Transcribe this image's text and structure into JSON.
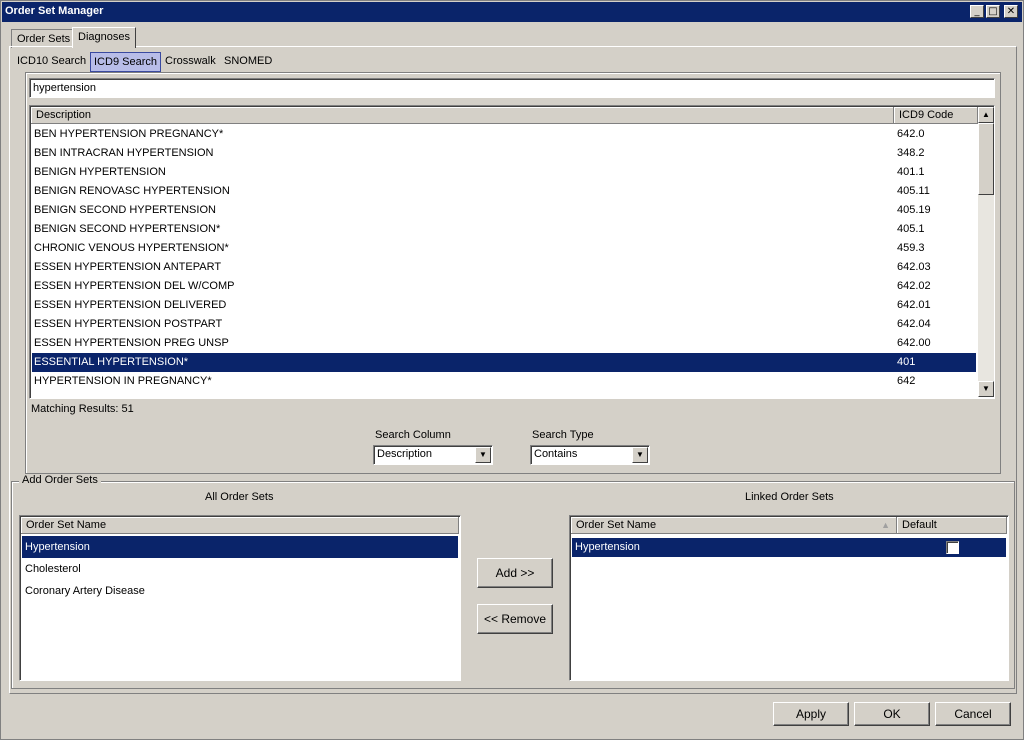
{
  "window": {
    "title": "Order Set Manager"
  },
  "tabs": [
    {
      "label": "Order Sets"
    },
    {
      "label": "Diagnoses"
    }
  ],
  "subtabs": [
    {
      "label": "ICD10 Search"
    },
    {
      "label": "ICD9 Search"
    },
    {
      "label": "Crosswalk"
    },
    {
      "label": "SNOMED"
    }
  ],
  "search": {
    "value": "hypertension"
  },
  "results": {
    "columns": [
      "Description",
      "ICD9 Code"
    ],
    "rows": [
      {
        "desc": "BEN HYPERTENSION PREGNANCY*",
        "code": "642.0"
      },
      {
        "desc": "BEN INTRACRAN HYPERTENSION",
        "code": "348.2"
      },
      {
        "desc": "BENIGN HYPERTENSION",
        "code": "401.1"
      },
      {
        "desc": "BENIGN RENOVASC HYPERTENSION",
        "code": "405.11"
      },
      {
        "desc": "BENIGN SECOND HYPERTENSION",
        "code": "405.19"
      },
      {
        "desc": "BENIGN SECOND HYPERTENSION*",
        "code": "405.1"
      },
      {
        "desc": "CHRONIC VENOUS HYPERTENSION*",
        "code": "459.3"
      },
      {
        "desc": "ESSEN HYPERTENSION ANTEPART",
        "code": "642.03"
      },
      {
        "desc": "ESSEN HYPERTENSION DEL W/COMP",
        "code": "642.02"
      },
      {
        "desc": "ESSEN HYPERTENSION DELIVERED",
        "code": "642.01"
      },
      {
        "desc": "ESSEN HYPERTENSION POSTPART",
        "code": "642.04"
      },
      {
        "desc": "ESSEN HYPERTENSION PREG UNSP",
        "code": "642.00"
      },
      {
        "desc": "ESSENTIAL HYPERTENSION*",
        "code": "401"
      },
      {
        "desc": "HYPERTENSION IN PREGNANCY*",
        "code": "642"
      }
    ],
    "selected_index": 12,
    "matching": "Matching Results: 51"
  },
  "search_column": {
    "label": "Search Column",
    "value": "Description"
  },
  "search_type": {
    "label": "Search Type",
    "value": "Contains"
  },
  "add_order_sets": {
    "group_label": "Add Order Sets",
    "all_label": "All Order Sets",
    "linked_label": "Linked Order Sets",
    "all_columns": [
      "Order Set Name"
    ],
    "all_items": [
      "Hypertension",
      "Cholesterol",
      "Coronary Artery Disease"
    ],
    "linked_columns": [
      "Order Set Name",
      "Default"
    ],
    "linked_items": [
      "Hypertension"
    ],
    "add_button": "Add >>",
    "remove_button": "<< Remove"
  },
  "buttons": {
    "apply": "Apply",
    "ok": "OK",
    "cancel": "Cancel"
  },
  "colors": {
    "selection": "#0a246a",
    "title_bar": "#0a246a",
    "face": "#d4d0c8"
  }
}
